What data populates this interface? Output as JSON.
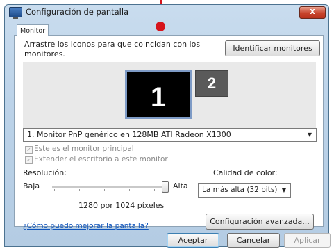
{
  "window": {
    "title": "Configuración de pantalla",
    "close_label": "X"
  },
  "tabs": [
    {
      "label": "Monitor",
      "selected": true
    }
  ],
  "monitor_tab": {
    "instruction": "Arrastre los iconos para que coincidan con los monitores.",
    "identify_button": "Identificar monitores",
    "monitors": [
      {
        "label": "1",
        "selected": true
      },
      {
        "label": "2",
        "selected": false
      }
    ],
    "monitor_select": "1. Monitor PnP genérico en 128MB ATI Radeon X1300",
    "primary_checkbox": {
      "label": "Este es el monitor principal",
      "checked": true,
      "enabled": false
    },
    "extend_checkbox": {
      "label": "Extender el escritorio a este monitor",
      "checked": true,
      "enabled": false
    },
    "resolution": {
      "label": "Resolución:",
      "low_label": "Baja",
      "high_label": "Alta",
      "value_text": "1280 por 1024 píxeles",
      "slider_level": 0.97
    },
    "color_quality": {
      "label": "Calidad de color:",
      "selected": "La más alta (32 bits)"
    },
    "help_link": "¿Cómo puedo mejorar la pantalla?",
    "advanced_button": "Configuración avanzada..."
  },
  "dialog_buttons": {
    "accept": "Aceptar",
    "cancel": "Cancelar",
    "apply": "Aplicar"
  },
  "colors": {
    "annotation": "#d6141c",
    "window_frame": "#bcd3e9",
    "link": "#1155bb"
  }
}
